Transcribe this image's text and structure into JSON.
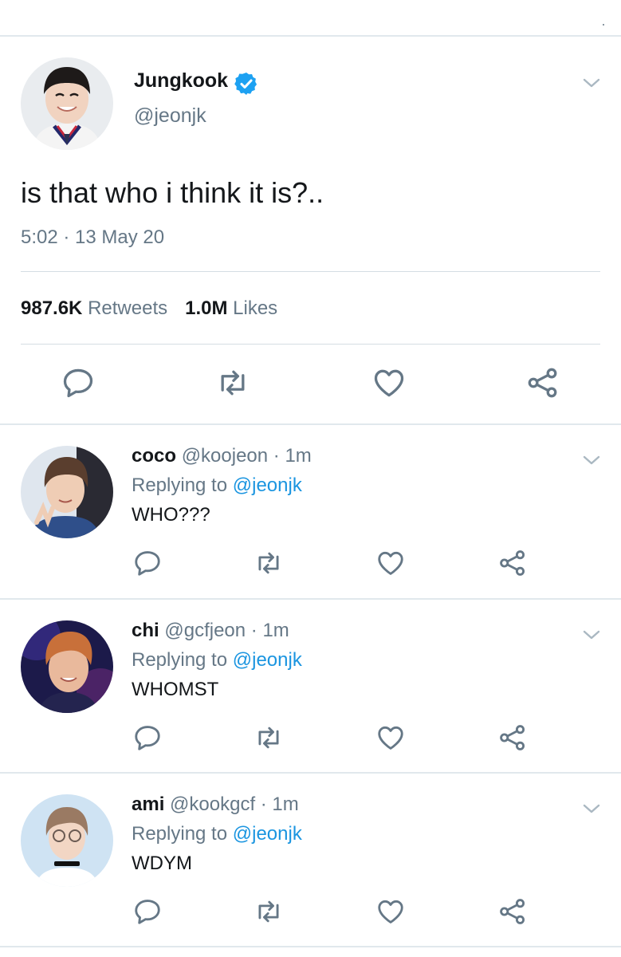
{
  "main_tweet": {
    "author_name": "Jungkook",
    "verified": true,
    "handle": "@jeonjk",
    "text": "is that who i think it is?..",
    "timestamp": "5:02 · 13 May 20",
    "retweets_count": "987.6K",
    "retweets_label": "Retweets",
    "likes_count": "1.0M",
    "likes_label": "Likes",
    "actions": [
      "reply-icon",
      "retweet-icon",
      "like-icon",
      "share-icon"
    ]
  },
  "replies": [
    {
      "name": "coco",
      "meta": "@koojeon · 1m",
      "replying_prefix": "Replying to ",
      "mention": "@jeonjk",
      "text": "WHO???"
    },
    {
      "name": "chi",
      "meta": "@gcfjeon · 1m",
      "replying_prefix": "Replying to ",
      "mention": "@jeonjk",
      "text": "WHOMST"
    },
    {
      "name": "ami",
      "meta": "@kookgcf · 1m",
      "replying_prefix": "Replying to ",
      "mention": "@jeonjk",
      "text": "WDYM"
    }
  ],
  "colors": {
    "text_primary": "#14171a",
    "text_secondary": "#657786",
    "link": "#1b95e0",
    "verified": "#1da1f2",
    "divider": "#e1e8ed"
  }
}
